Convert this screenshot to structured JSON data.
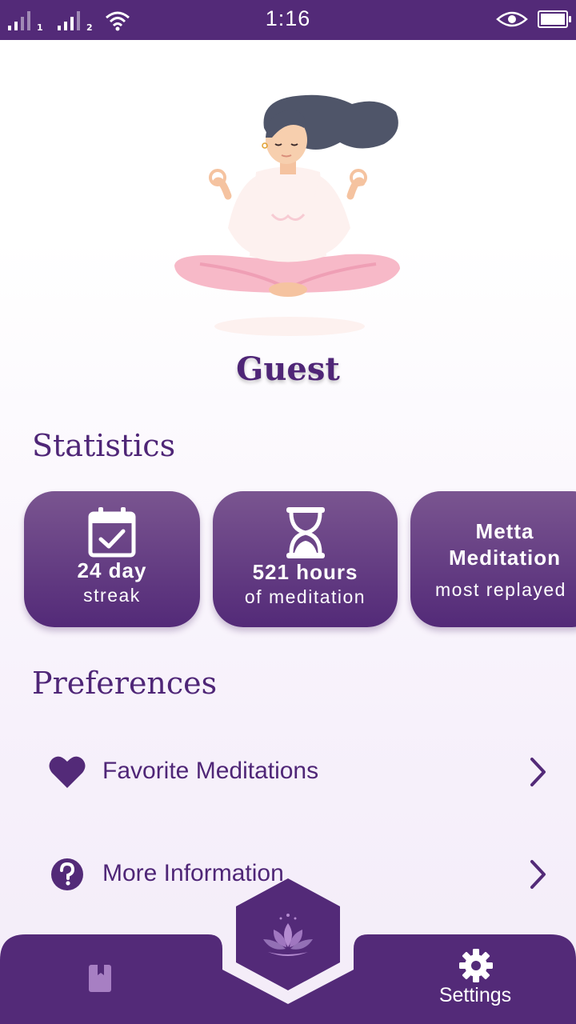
{
  "status_bar": {
    "time": "1:16",
    "sim1": "1",
    "sim2": "2",
    "icons": [
      "signal-icon",
      "signal-icon",
      "wifi-icon",
      "eye-icon",
      "battery-icon"
    ]
  },
  "profile": {
    "name": "Guest"
  },
  "statistics": {
    "title": "Statistics",
    "cards": [
      {
        "main": "24 day",
        "sub": "streak",
        "icon": "calendar-check-icon"
      },
      {
        "main": "521 hours",
        "sub": "of meditation",
        "icon": "hourglass-icon"
      },
      {
        "main_line1": "Metta",
        "main_line2": "Meditation",
        "sub": "most replayed"
      }
    ]
  },
  "preferences": {
    "title": "Preferences",
    "items": [
      {
        "label": "Favorite Meditations",
        "icon": "heart-icon"
      },
      {
        "label": "More Information",
        "icon": "question-circle-icon"
      }
    ]
  },
  "bottom_nav": {
    "items": [
      {
        "label": "",
        "icon": "book-icon"
      },
      {
        "label": "",
        "icon": "lotus-icon"
      },
      {
        "label": "Settings",
        "icon": "gear-icon"
      }
    ]
  },
  "colors": {
    "primary": "#532a78",
    "accent_text": "#4f2677",
    "card_top": "#7a5590"
  }
}
